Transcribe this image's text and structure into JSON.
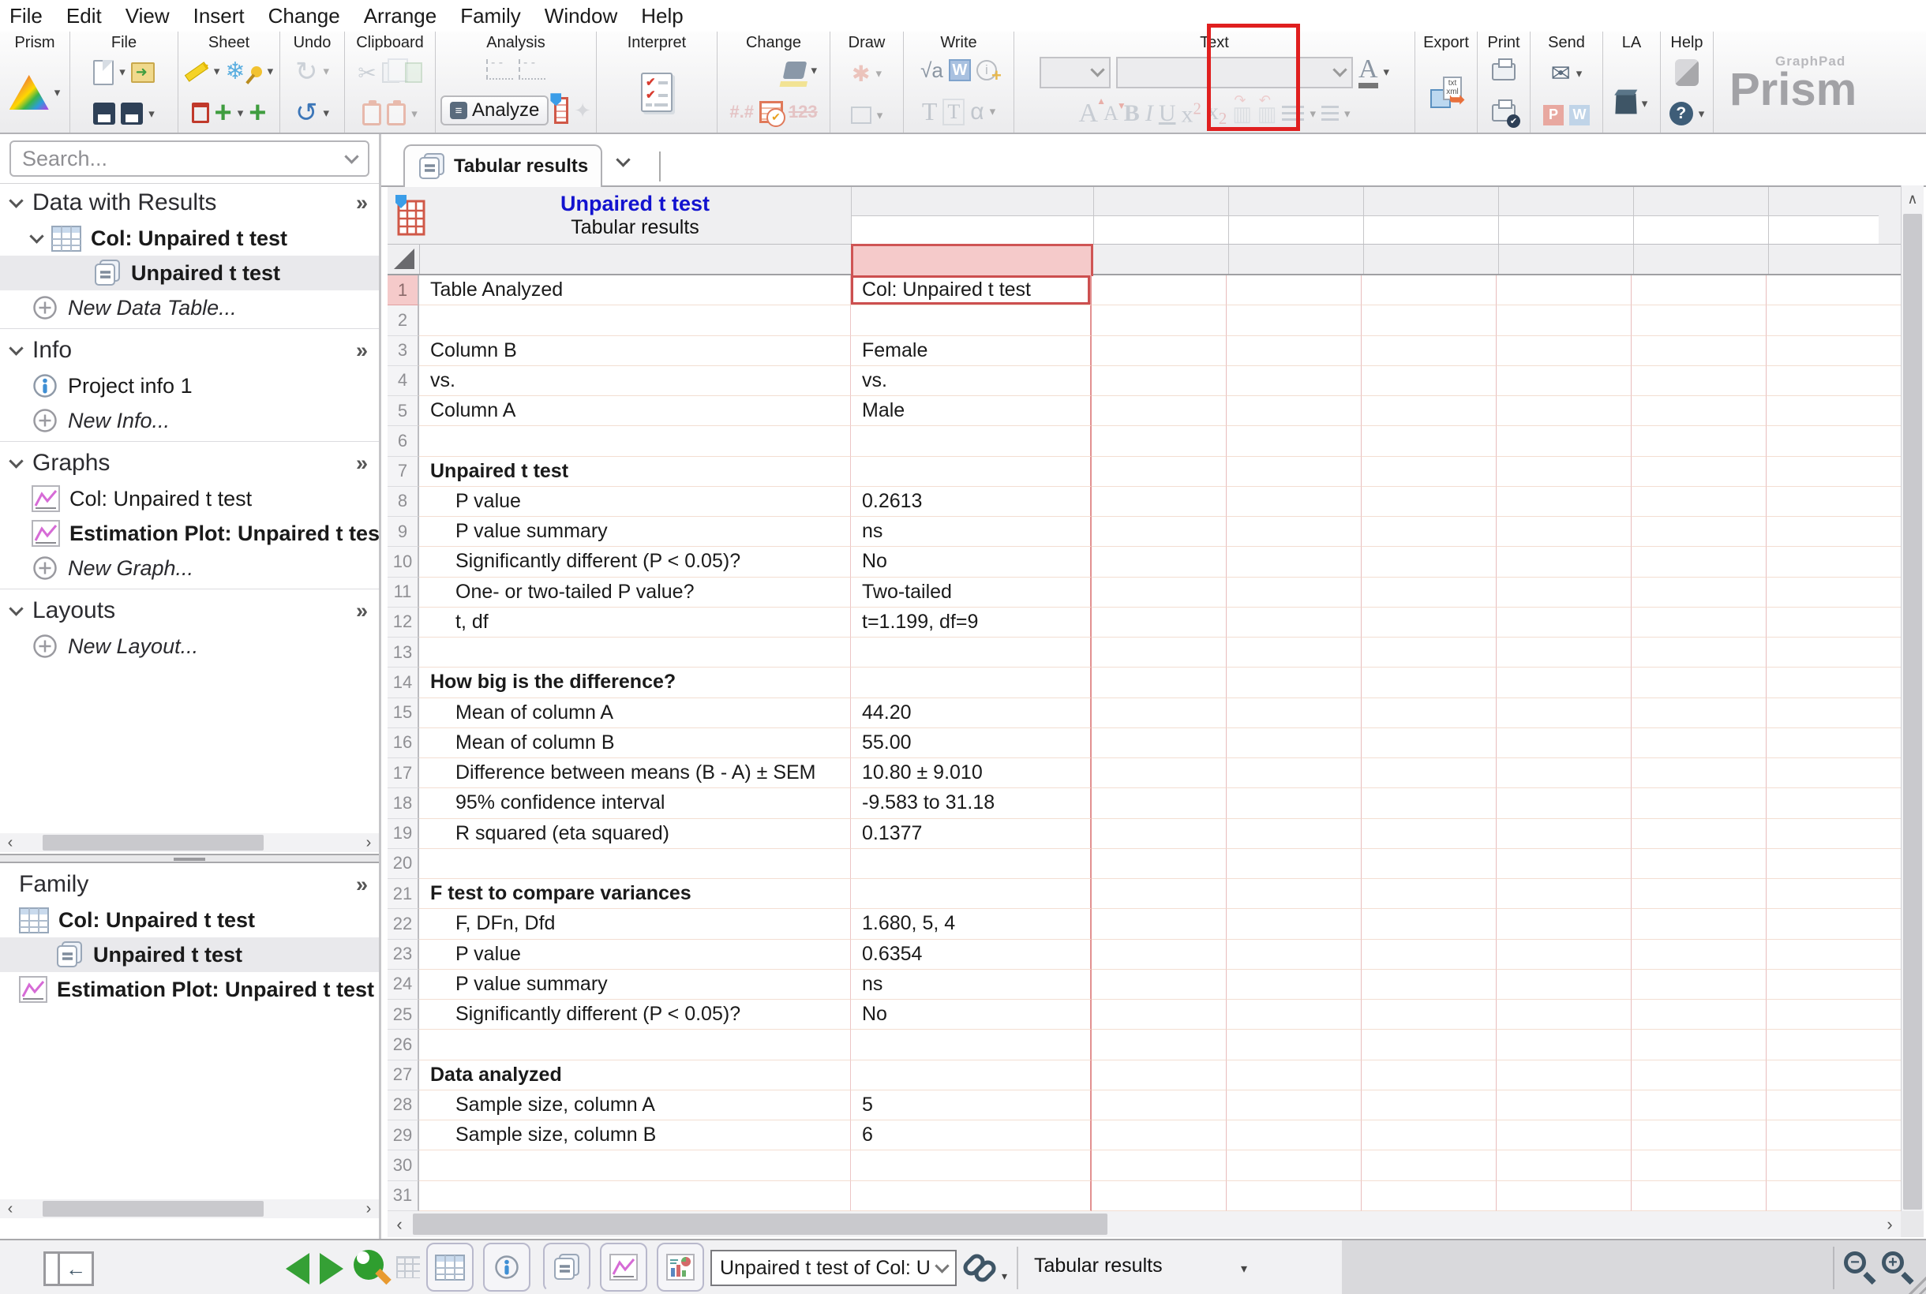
{
  "menu": [
    "File",
    "Edit",
    "View",
    "Insert",
    "Change",
    "Arrange",
    "Family",
    "Window",
    "Help"
  ],
  "toolbar": {
    "groups": [
      "Prism",
      "File",
      "Sheet",
      "Undo",
      "Clipboard",
      "Analysis",
      "Interpret",
      "Change",
      "Draw",
      "Write",
      "Text",
      "Export",
      "Print",
      "Send",
      "LA",
      "Help"
    ],
    "analyze_label": "Analyze",
    "logo_top": "GraphPad",
    "logo_main": "Prism",
    "interpret_highlight_color": "#e01f1f"
  },
  "sidebar": {
    "search_placeholder": "Search...",
    "sections": [
      {
        "title": "Data with Results",
        "items": [
          {
            "label": "Col: Unpaired t test",
            "icon": "table",
            "bold": true,
            "indent": 1,
            "chevron": true
          },
          {
            "label": "Unpaired t test",
            "icon": "results",
            "bold": true,
            "indent": 2,
            "selected": true
          },
          {
            "label": "New Data Table...",
            "icon": "plus",
            "italic": true,
            "indent": 1
          }
        ]
      },
      {
        "title": "Info",
        "items": [
          {
            "label": "Project info 1",
            "icon": "info",
            "indent": 1
          },
          {
            "label": "New Info...",
            "icon": "plus",
            "italic": true,
            "indent": 1
          }
        ]
      },
      {
        "title": "Graphs",
        "items": [
          {
            "label": "Col: Unpaired t test",
            "icon": "graph",
            "indent": 1
          },
          {
            "label": "Estimation Plot: Unpaired t test of",
            "icon": "graph",
            "bold": true,
            "indent": 1
          },
          {
            "label": "New Graph...",
            "icon": "plus",
            "italic": true,
            "indent": 1
          }
        ]
      },
      {
        "title": "Layouts",
        "items": [
          {
            "label": "New Layout...",
            "icon": "plus",
            "italic": true,
            "indent": 1
          }
        ]
      }
    ]
  },
  "family": {
    "title": "Family",
    "items": [
      {
        "label": "Col: Unpaired t test",
        "icon": "table",
        "bold": true,
        "indent": 0
      },
      {
        "label": "Unpaired t test",
        "icon": "results",
        "bold": true,
        "indent": 1,
        "selected": true
      },
      {
        "label": "Estimation Plot: Unpaired t test of",
        "icon": "graph",
        "bold": true,
        "indent": 0
      }
    ]
  },
  "content": {
    "tab_label": "Tabular results",
    "sheet_title": "Unpaired t test",
    "sheet_subtitle": "Tabular results",
    "rows": [
      {
        "n": 1,
        "label": "Table Analyzed",
        "value": "Col: Unpaired t test"
      },
      {
        "n": 2,
        "label": "",
        "value": ""
      },
      {
        "n": 3,
        "label": "Column B",
        "value": "Female"
      },
      {
        "n": 4,
        "label": "vs.",
        "value": "vs."
      },
      {
        "n": 5,
        "label": "Column A",
        "value": "Male"
      },
      {
        "n": 6,
        "label": "",
        "value": ""
      },
      {
        "n": 7,
        "label": "Unpaired t test",
        "value": "",
        "bold": true
      },
      {
        "n": 8,
        "label": "P value",
        "value": "0.2613",
        "indent": true
      },
      {
        "n": 9,
        "label": "P value summary",
        "value": "ns",
        "indent": true
      },
      {
        "n": 10,
        "label": "Significantly different (P < 0.05)?",
        "value": "No",
        "indent": true
      },
      {
        "n": 11,
        "label": "One- or two-tailed P value?",
        "value": "Two-tailed",
        "indent": true
      },
      {
        "n": 12,
        "label": "t, df",
        "value": "t=1.199, df=9",
        "indent": true
      },
      {
        "n": 13,
        "label": "",
        "value": ""
      },
      {
        "n": 14,
        "label": "How big is the difference?",
        "value": "",
        "bold": true
      },
      {
        "n": 15,
        "label": "Mean of column A",
        "value": "44.20",
        "indent": true
      },
      {
        "n": 16,
        "label": "Mean of column B",
        "value": "55.00",
        "indent": true
      },
      {
        "n": 17,
        "label": "Difference between means (B - A) ± SEM",
        "value": "10.80 ± 9.010",
        "indent": true
      },
      {
        "n": 18,
        "label": "95% confidence interval",
        "value": "-9.583 to 31.18",
        "indent": true
      },
      {
        "n": 19,
        "label": "R squared (eta squared)",
        "value": "0.1377",
        "indent": true
      },
      {
        "n": 20,
        "label": "",
        "value": ""
      },
      {
        "n": 21,
        "label": "F test to compare variances",
        "value": "",
        "bold": true
      },
      {
        "n": 22,
        "label": "F, DFn, Dfd",
        "value": "1.680, 5, 4",
        "indent": true
      },
      {
        "n": 23,
        "label": "P value",
        "value": "0.6354",
        "indent": true
      },
      {
        "n": 24,
        "label": "P value summary",
        "value": "ns",
        "indent": true
      },
      {
        "n": 25,
        "label": "Significantly different (P < 0.05)?",
        "value": "No",
        "indent": true
      },
      {
        "n": 26,
        "label": "",
        "value": ""
      },
      {
        "n": 27,
        "label": "Data analyzed",
        "value": "",
        "bold": true
      },
      {
        "n": 28,
        "label": "Sample size, column A",
        "value": "5",
        "indent": true
      },
      {
        "n": 29,
        "label": "Sample size, column B",
        "value": "6",
        "indent": true
      },
      {
        "n": 30,
        "label": "",
        "value": ""
      },
      {
        "n": 31,
        "label": "",
        "value": ""
      }
    ]
  },
  "status": {
    "navigator_dropdown": "Unpaired t test of Col: Unpaired",
    "sheet_label": "Tabular results"
  },
  "colors": {
    "selection_red": "#cc4f4f",
    "header_pink": "#f5caca",
    "sheet_title_blue": "#1313cf",
    "grid_vertical": "#e8bcbc",
    "grid_horizontal": "#f3ded2"
  },
  "icons": {
    "chevron-down": "⌄",
    "expand-more": "»",
    "plus-circle": "⊕",
    "info-circle": "ⓘ",
    "zoom-out": "−",
    "zoom-in": "+",
    "nav-back": "◀",
    "nav-forward": "▶"
  }
}
